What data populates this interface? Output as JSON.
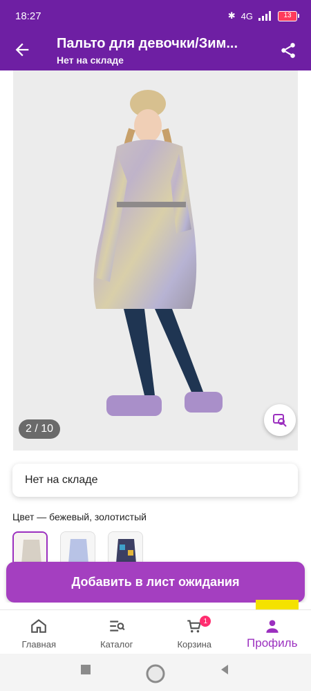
{
  "status": {
    "time": "18:27",
    "signal": "4G",
    "battery": "13",
    "bluetooth_icon": "bluetooth-icon"
  },
  "app_bar": {
    "title": "Пальто для девочки/Зим...",
    "subtitle": "Нет на складе",
    "back_icon": "back-arrow-icon",
    "share_icon": "share-icon"
  },
  "gallery": {
    "counter": "2 / 10",
    "zoom_icon": "image-search-icon"
  },
  "stock": {
    "text": "Нет на складе"
  },
  "color": {
    "label": "Цвет — бежевый, золотистый",
    "options": [
      {
        "name": "бежевый, золотистый",
        "selected": true
      },
      {
        "name": "голубой",
        "selected": false
      },
      {
        "name": "мультиколор",
        "selected": false
      }
    ]
  },
  "cta": {
    "label": "Добавить в лист ожидания"
  },
  "bottom_nav": {
    "items": [
      {
        "label": "Главная",
        "icon": "home-icon"
      },
      {
        "label": "Каталог",
        "icon": "catalog-search-icon"
      },
      {
        "label": "Корзина",
        "icon": "cart-icon",
        "badge": "1"
      },
      {
        "label": "Профиль",
        "icon": "profile-icon",
        "active": true
      }
    ]
  },
  "colors": {
    "primary": "#6e1fa3",
    "accent": "#a43fc0",
    "badge": "#ff2d6f"
  }
}
